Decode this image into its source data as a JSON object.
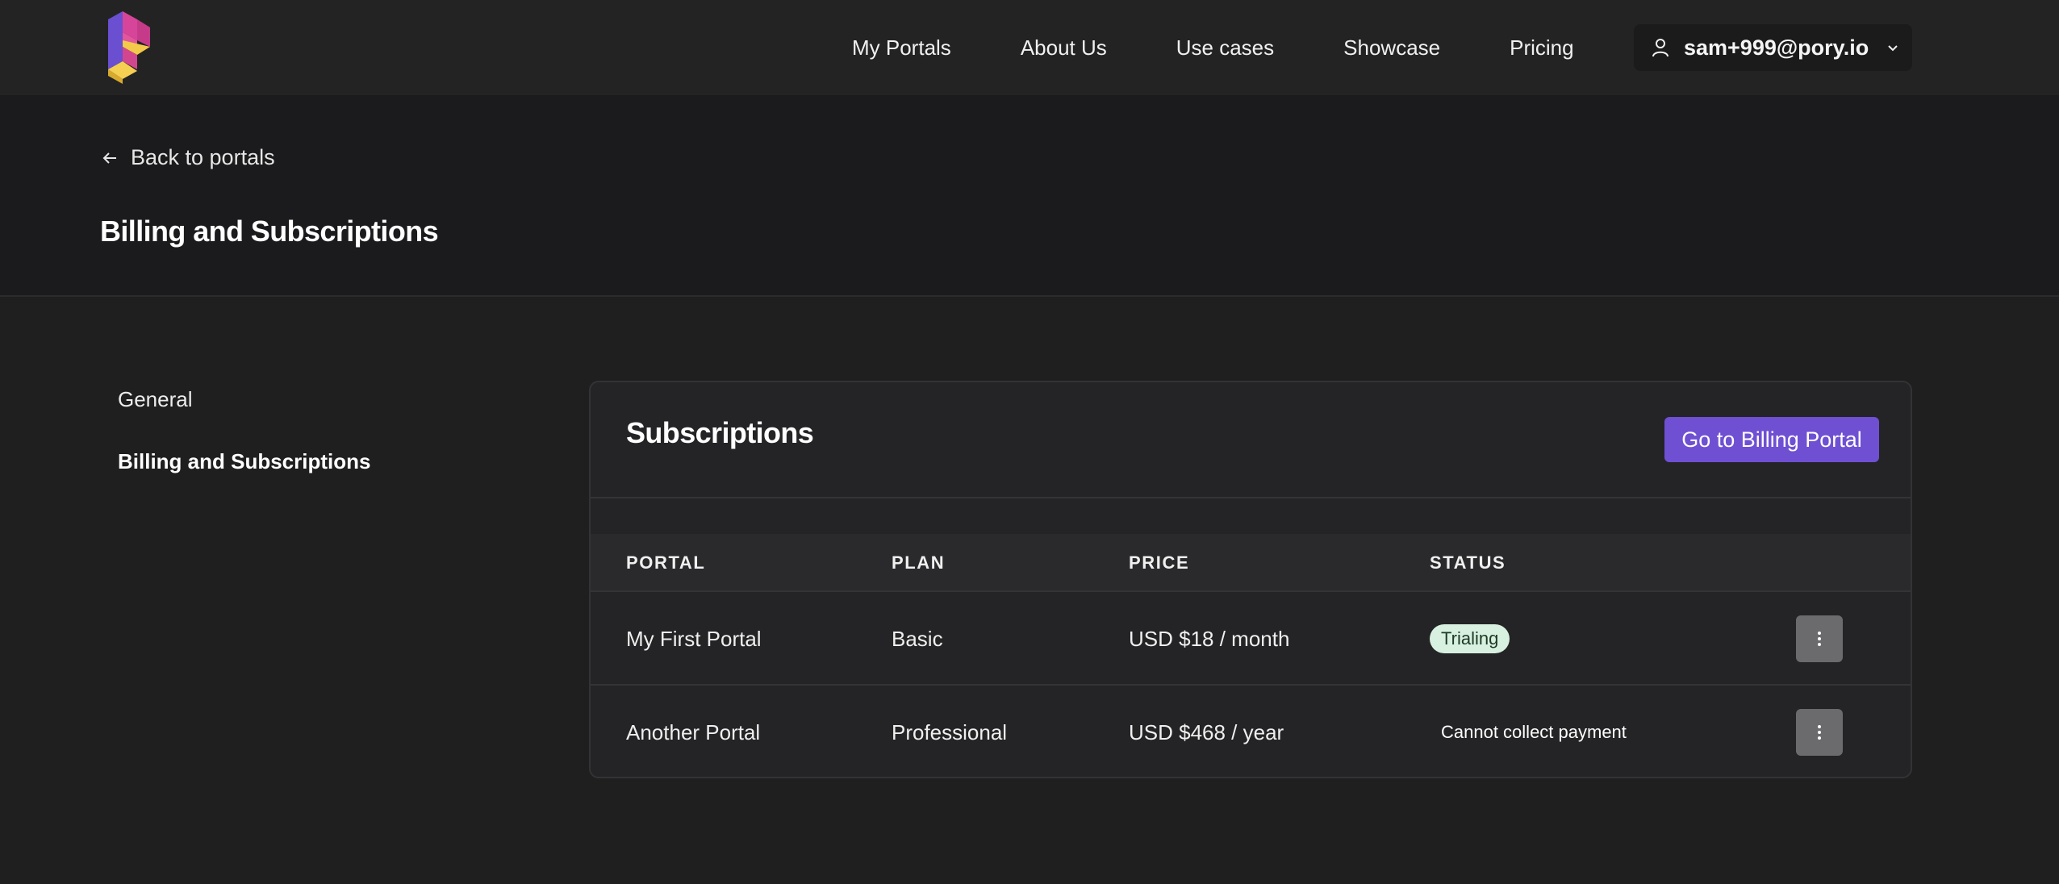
{
  "nav": {
    "links": [
      "My Portals",
      "About Us",
      "Use cases",
      "Showcase",
      "Pricing"
    ],
    "user_email": "sam+999@pory.io",
    "icons": {
      "user": "user-icon",
      "chevron": "chevron-down-icon"
    }
  },
  "header": {
    "back_label": "Back to portals",
    "title": "Billing and Subscriptions"
  },
  "sidebar": {
    "items": [
      {
        "label": "General",
        "active": false
      },
      {
        "label": "Billing and Subscriptions",
        "active": true
      }
    ]
  },
  "subscriptions": {
    "title": "Subscriptions",
    "billing_button": "Go to Billing Portal",
    "columns": [
      "PORTAL",
      "PLAN",
      "PRICE",
      "STATUS"
    ],
    "rows": [
      {
        "portal": "My First Portal",
        "plan": "Basic",
        "price": "USD $18 / month",
        "status": "Trialing"
      },
      {
        "portal": "Another Portal",
        "plan": "Professional",
        "price": "USD $468 / year",
        "status": "Cannot collect payment"
      }
    ]
  },
  "colors": {
    "accent": "#6f50d3",
    "trial_badge_bg": "#d8f0df",
    "background": "#1f1f1f"
  }
}
